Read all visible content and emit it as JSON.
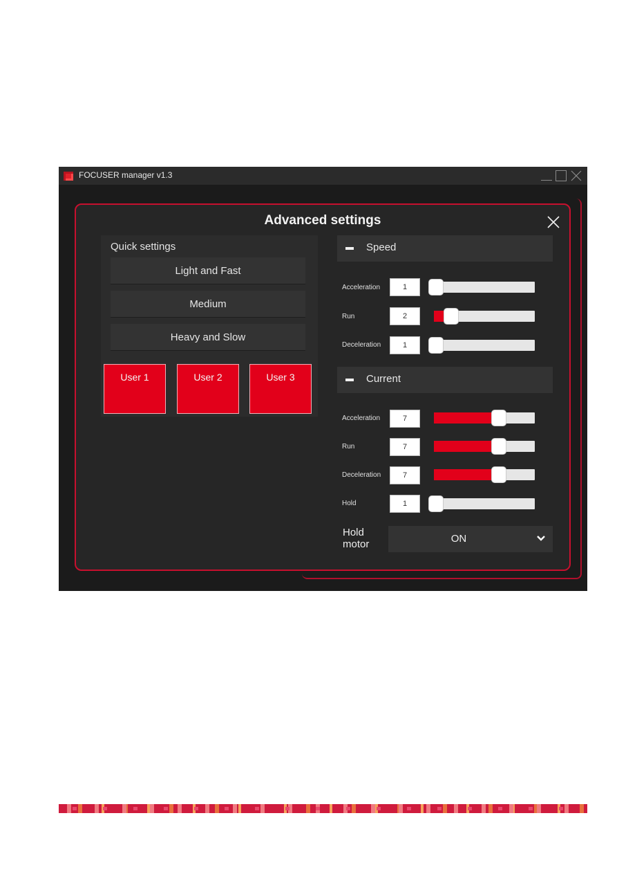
{
  "window": {
    "title": "FOCUSER manager v1.3",
    "accent_color": "#e2001a"
  },
  "dialog": {
    "title": "Advanced settings"
  },
  "quick_settings": {
    "label": "Quick settings",
    "presets": [
      "Light and Fast",
      "Medium",
      "Heavy and Slow"
    ],
    "users": [
      "User 1",
      "User 2",
      "User 3"
    ]
  },
  "speed": {
    "title": "Speed",
    "rows": [
      {
        "label": "Acceleration",
        "value": "1",
        "fraction": 0.0
      },
      {
        "label": "Run",
        "value": "2",
        "fraction": 0.11
      },
      {
        "label": "Deceleration",
        "value": "1",
        "fraction": 0.0
      }
    ]
  },
  "current": {
    "title": "Current",
    "rows": [
      {
        "label": "Acceleration",
        "value": "7",
        "fraction": 0.67
      },
      {
        "label": "Run",
        "value": "7",
        "fraction": 0.67
      },
      {
        "label": "Deceleration",
        "value": "7",
        "fraction": 0.67
      },
      {
        "label": "Hold",
        "value": "1",
        "fraction": 0.0
      }
    ]
  },
  "hold_motor": {
    "label_line1": "Hold",
    "label_line2": "motor",
    "value": "ON"
  }
}
